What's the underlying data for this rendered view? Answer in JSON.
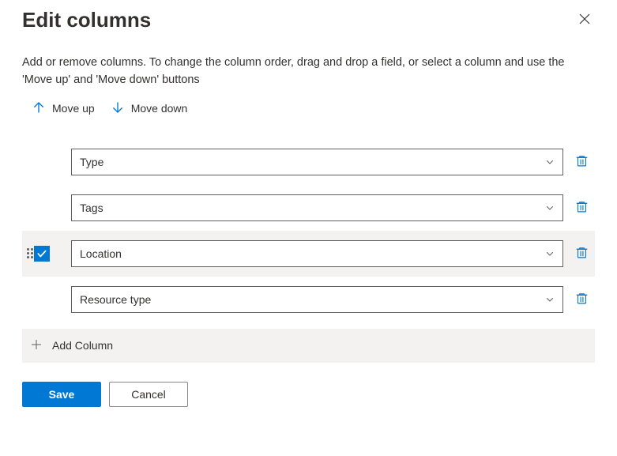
{
  "header": {
    "title": "Edit columns"
  },
  "description": "Add or remove columns. To change the column order, drag and drop a field, or select a column and use the 'Move up' and 'Move down' buttons",
  "actions": {
    "moveUp": "Move up",
    "moveDown": "Move down",
    "addColumn": "Add Column",
    "save": "Save",
    "cancel": "Cancel"
  },
  "columns": [
    {
      "label": "Type",
      "selected": false
    },
    {
      "label": "Tags",
      "selected": false
    },
    {
      "label": "Location",
      "selected": true
    },
    {
      "label": "Resource type",
      "selected": false
    }
  ]
}
